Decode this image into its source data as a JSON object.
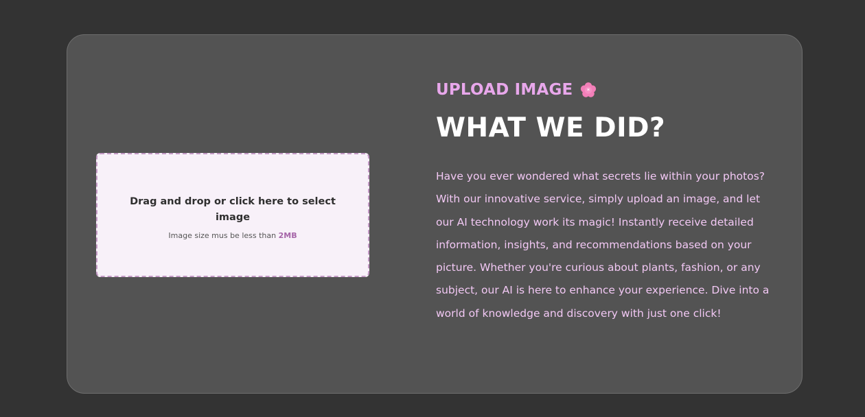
{
  "upload": {
    "title": "Drag and drop or click here to select image",
    "hint_prefix": "Image size mus be less than",
    "hint_size": "2MB"
  },
  "about": {
    "eyebrow": "UPLOAD IMAGE",
    "eyebrow_icon": "cherry-blossom-icon",
    "headline": "WHAT WE DID?",
    "description": "Have you ever wondered what secrets lie within your photos? With our innovative service, simply upload an image, and let our AI technology work its magic! Instantly receive detailed information, insights, and recommendations based on your picture. Whether you're curious about plants, fashion, or any subject, our AI is here to enhance your experience. Dive into a world of knowledge and discovery with just one click!"
  },
  "colors": {
    "background": "#333333",
    "card": "#535353",
    "accent": "#e8a7eb",
    "dropzone": "#f8f1f9",
    "size_highlight": "#a564a8"
  }
}
